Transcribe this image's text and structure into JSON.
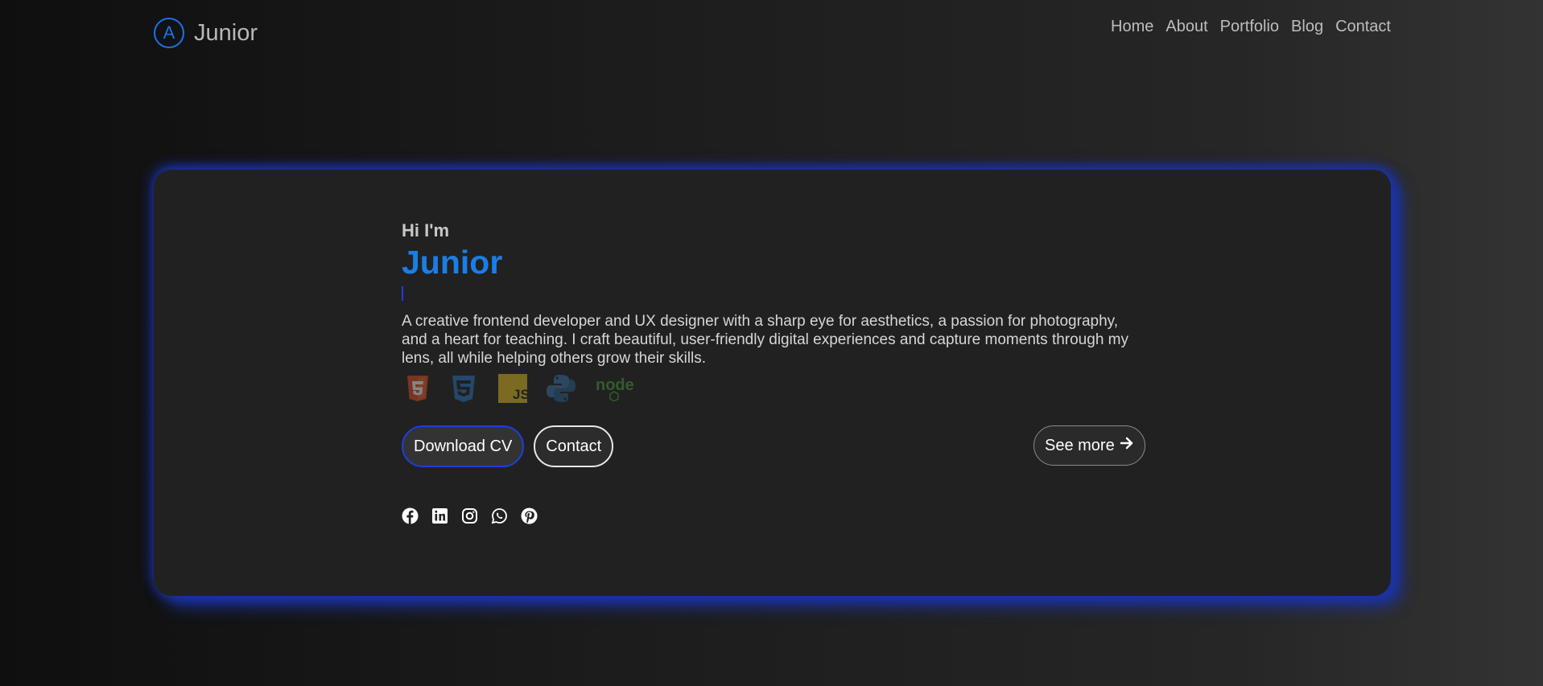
{
  "nav": {
    "logo_letter": "A",
    "logo_text": "Junior",
    "links": [
      "Home",
      "About",
      "Portfolio",
      "Blog",
      "Contact"
    ]
  },
  "hero": {
    "greeting": "Hi I'm",
    "name": "Junior",
    "description": "A creative frontend developer and UX designer with a sharp eye for aesthetics, a passion for photography, and a heart for teaching. I craft beautiful, user-friendly digital experiences and capture moments through my lens, all while helping others grow their skills.",
    "tech_icons": [
      "html5-icon",
      "css3-icon",
      "javascript-icon",
      "python-icon",
      "nodejs-icon"
    ],
    "js_badge_text": "JS",
    "node_badge_text": "node",
    "download_cv_label": "Download CV",
    "contact_label": "Contact",
    "see_more_label": "See more",
    "socials": [
      "facebook-icon",
      "linkedin-icon",
      "instagram-icon",
      "whatsapp-icon",
      "pinterest-icon"
    ]
  },
  "colors": {
    "accent": "#1a7ee6",
    "glow": "#1b33a8",
    "card_bg": "#212121"
  }
}
